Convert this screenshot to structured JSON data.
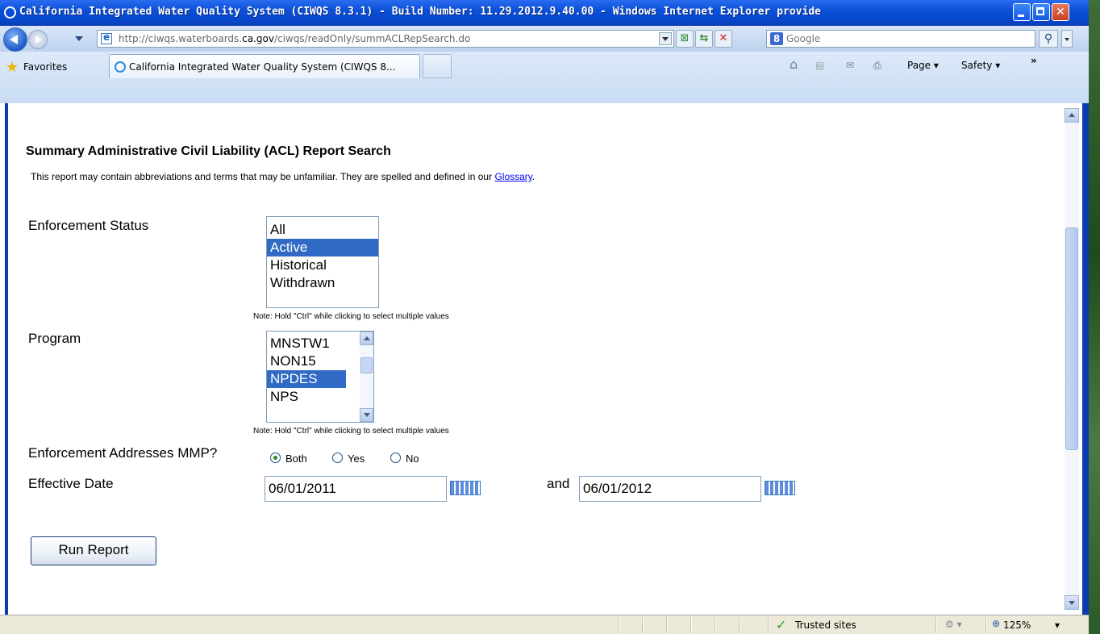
{
  "window": {
    "title": "California Integrated Water Quality System (CIWQS 8.3.1) - Build Number: 11.29.2012.9.40.00 - Windows Internet Explorer provide"
  },
  "address": {
    "url_prefix": "http://ciwqs.waterboards.",
    "url_domain": "ca.gov",
    "url_suffix": "/ciwqs/readOnly/summACLRepSearch.do"
  },
  "search": {
    "placeholder": "Google"
  },
  "favorites": {
    "label": "Favorites"
  },
  "tab": {
    "label": "California Integrated Water Quality System (CIWQS 8..."
  },
  "commandbar": {
    "page": "Page ▾",
    "safety": "Safety ▾",
    "more": "»"
  },
  "page": {
    "title": "Summary Administrative Civil Liability (ACL) Report Search",
    "intro": "This report may contain abbreviations and terms that may be unfamiliar. They are spelled and defined in our ",
    "glossary_link": "Glossary",
    "intro_end": ".",
    "enforcement_status": {
      "label": "Enforcement Status",
      "options": [
        "All",
        "Active",
        "Historical",
        "Withdrawn"
      ],
      "selected": "Active",
      "note": "Note: Hold \"Ctrl\" while clicking to select multiple values"
    },
    "program": {
      "label": "Program",
      "options": [
        "MNSTW1",
        "NON15",
        "NPDES",
        "NPS"
      ],
      "selected": "NPDES",
      "note": "Note: Hold \"Ctrl\" while clicking to select multiple values"
    },
    "mmp": {
      "label": "Enforcement Addresses MMP?",
      "options": [
        "Both",
        "Yes",
        "No"
      ],
      "selected": "Both"
    },
    "effective_date": {
      "label": "Effective Date",
      "from": "06/01/2011",
      "and_label": "and",
      "to": "06/01/2012"
    },
    "run_button": "Run Report"
  },
  "status": {
    "zone": "Trusted sites",
    "zoom": "125%"
  },
  "icons": [
    "ie-logo-icon",
    "back-arrow-icon",
    "forward-arrow-icon",
    "page-icon",
    "compat-view-icon",
    "refresh-icon",
    "stop-icon",
    "google-icon",
    "search-icon",
    "favorites-star-icon",
    "home-icon",
    "feeds-icon",
    "mail-icon",
    "print-icon",
    "calendar-icon",
    "trusted-check-icon",
    "zoom-icon"
  ]
}
